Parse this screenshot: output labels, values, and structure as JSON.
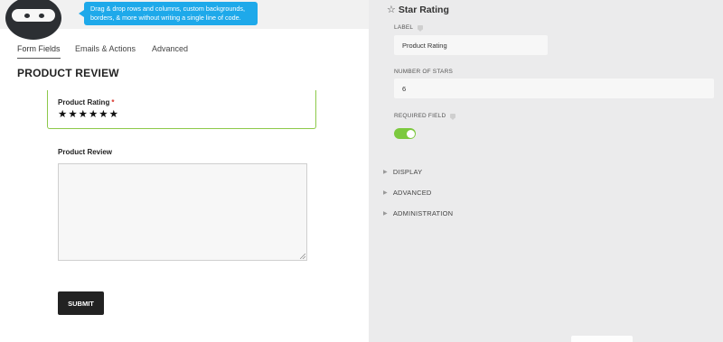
{
  "header": {
    "tooltip_text": "Drag & drop rows and columns, custom backgrounds, borders, & more without writing a single line of code."
  },
  "tabs": [
    {
      "label": "Form Fields"
    },
    {
      "label": "Emails & Actions"
    },
    {
      "label": "Advanced"
    }
  ],
  "form": {
    "title": "PRODUCT REVIEW",
    "rating_label": "Product Rating",
    "required_mark": "*",
    "stars": [
      "★",
      "★",
      "★",
      "★",
      "★",
      "★"
    ],
    "review_label": "Product Review",
    "submit_label": "SUBMIT"
  },
  "settings": {
    "title_icon": "☆",
    "title": "Star Rating",
    "label_label": "LABEL",
    "label_value": "Product Rating",
    "num_stars_label": "NUMBER OF STARS",
    "num_stars_value": "6",
    "required_label": "REQUIRED FIELD",
    "required_on": true,
    "sections": [
      {
        "label": "DISPLAY"
      },
      {
        "label": "ADVANCED"
      },
      {
        "label": "ADMINISTRATION"
      }
    ]
  },
  "colors": {
    "accent_green": "#7cc93e",
    "tooltip_blue": "#1ea9ea",
    "required_red": "#d9342b"
  }
}
